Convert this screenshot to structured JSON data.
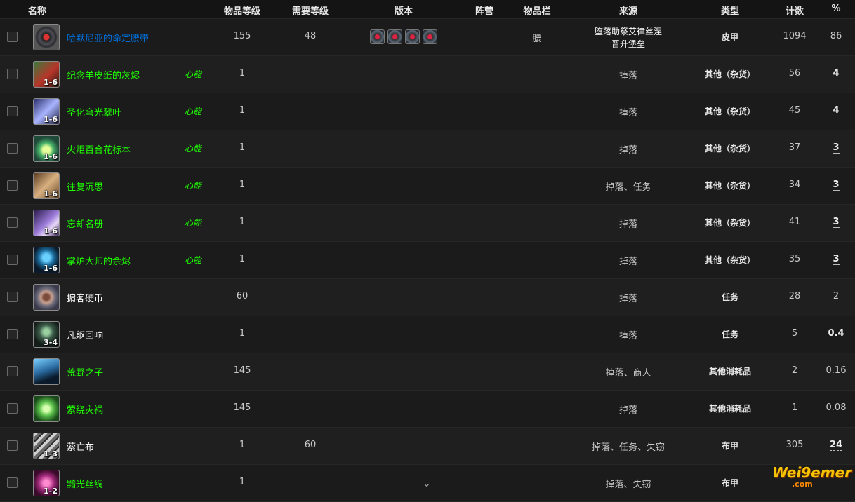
{
  "columns": {
    "name": "名称",
    "ilvl": "物品等级",
    "req": "需要等级",
    "version": "版本",
    "faction": "阵营",
    "slot": "物品栏",
    "source": "来源",
    "type": "类型",
    "count": "计数",
    "pct": "%"
  },
  "rows": [
    {
      "icon": "belt-icon",
      "qty": "",
      "name": "哈默尼亚的命定腰带",
      "tag": "",
      "ilvl": "155",
      "req": "48",
      "slot": "腰",
      "source_line1": "堕落助祭艾律丝涅",
      "source_line2": "晋升堡垒",
      "type": "皮甲",
      "count": "1094",
      "pct": "86"
    },
    {
      "icon": "ash-icon",
      "qty": "1-6",
      "name": "纪念羊皮纸的灰烬",
      "tag": "心能",
      "ilvl": "1",
      "req": "",
      "slot": "",
      "source_line1": "掉落",
      "source_line2": "",
      "type": "其他（杂货）",
      "count": "56",
      "pct": "4"
    },
    {
      "icon": "leaf-icon",
      "qty": "1-6",
      "name": "圣化穹光翠叶",
      "tag": "心能",
      "ilvl": "1",
      "req": "",
      "slot": "",
      "source_line1": "掉落",
      "source_line2": "",
      "type": "其他（杂货）",
      "count": "45",
      "pct": "4"
    },
    {
      "icon": "lily-icon",
      "qty": "1-6",
      "name": "火炬百合花标本",
      "tag": "心能",
      "ilvl": "1",
      "req": "",
      "slot": "",
      "source_line1": "掉落",
      "source_line2": "",
      "type": "其他（杂货）",
      "count": "37",
      "pct": "3"
    },
    {
      "icon": "scroll-icon",
      "qty": "1-6",
      "name": "往复沉思",
      "tag": "心能",
      "ilvl": "1",
      "req": "",
      "slot": "",
      "source_line1": "掉落、任务",
      "source_line2": "",
      "type": "其他（杂货）",
      "count": "34",
      "pct": "3"
    },
    {
      "icon": "book-icon",
      "qty": "1-6",
      "name": "忘却名册",
      "tag": "心能",
      "ilvl": "1",
      "req": "",
      "slot": "",
      "source_line1": "掉落",
      "source_line2": "",
      "type": "其他（杂货）",
      "count": "41",
      "pct": "3"
    },
    {
      "icon": "ember-icon",
      "qty": "1-6",
      "name": "掌炉大师的余烬",
      "tag": "心能",
      "ilvl": "1",
      "req": "",
      "slot": "",
      "source_line1": "掉落",
      "source_line2": "",
      "type": "其他（杂货）",
      "count": "35",
      "pct": "3"
    },
    {
      "icon": "coin-icon",
      "qty": "",
      "name": "掮客硬币",
      "tag": "",
      "ilvl": "60",
      "req": "",
      "slot": "",
      "source_line1": "掉落",
      "source_line2": "",
      "type": "任务",
      "count": "28",
      "pct": "2"
    },
    {
      "icon": "ghost-icon",
      "qty": "3-4",
      "name": "凡躯回响",
      "tag": "",
      "ilvl": "1",
      "req": "",
      "slot": "",
      "source_line1": "掉落",
      "source_line2": "",
      "type": "任务",
      "count": "5",
      "pct": "0.4"
    },
    {
      "icon": "wolf-icon",
      "qty": "",
      "name": "荒野之子",
      "tag": "",
      "ilvl": "145",
      "req": "",
      "slot": "",
      "source_line1": "掉落、商人",
      "source_line2": "",
      "type": "其他消耗品",
      "count": "2",
      "pct": "0.16"
    },
    {
      "icon": "monster-icon",
      "qty": "",
      "name": "萦绕灾祸",
      "tag": "",
      "ilvl": "145",
      "req": "",
      "slot": "",
      "source_line1": "掉落",
      "source_line2": "",
      "type": "其他消耗品",
      "count": "1",
      "pct": "0.08"
    },
    {
      "icon": "cloth-icon",
      "qty": "1-3",
      "name": "萦亡布",
      "tag": "",
      "ilvl": "1",
      "req": "60",
      "slot": "",
      "source_line1": "掉落、任务、失窃",
      "source_line2": "",
      "type": "布甲",
      "count": "305",
      "pct": "24"
    },
    {
      "icon": "silk-icon",
      "qty": "1-2",
      "name": "黯光丝绸",
      "tag": "",
      "ilvl": "1",
      "req": "",
      "slot": "",
      "source_line1": "掉落、失窃",
      "source_line2": "",
      "type": "布甲",
      "count": "",
      "pct": ""
    }
  ],
  "watermark": {
    "brand": "Wei9emer",
    "domain": ".com"
  }
}
